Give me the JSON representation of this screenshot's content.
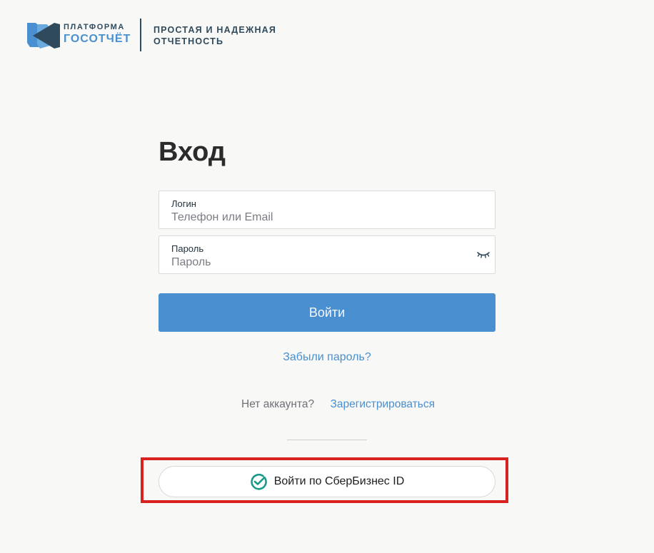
{
  "header": {
    "logo_line1": "ПЛАТФОРМА",
    "logo_line2": "ГОСОТЧЁТ",
    "tagline": "ПРОСТАЯ И НАДЕЖНАЯ ОТЧЕТНОСТЬ"
  },
  "form": {
    "title": "Вход",
    "login": {
      "label": "Логин",
      "placeholder": "Телефон или Email",
      "value": ""
    },
    "password": {
      "label": "Пароль",
      "placeholder": "Пароль",
      "value": ""
    },
    "submit_label": "Войти",
    "forgot_label": "Забыли пароль?",
    "no_account_text": "Нет аккаунта?",
    "register_label": "Зарегистрироваться",
    "sber_label": "Войти по СберБизнес ID"
  },
  "icons": {
    "logo": "gosotchet-logo-icon",
    "eye": "eye-closed-icon",
    "sber": "sber-check-icon"
  },
  "colors": {
    "accent": "#4a8fd0",
    "brand_dark": "#2f4a5c",
    "sber_green": "#1a9a8a",
    "highlight": "#d8221f",
    "background": "#f8f8f6"
  }
}
